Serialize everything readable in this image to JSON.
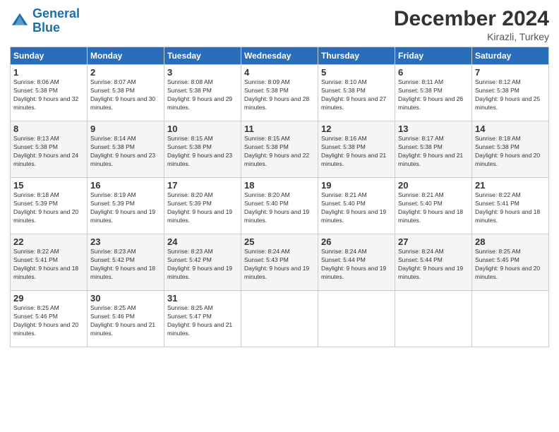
{
  "header": {
    "logo_line1": "General",
    "logo_line2": "Blue",
    "title": "December 2024",
    "subtitle": "Kirazli, Turkey"
  },
  "columns": [
    "Sunday",
    "Monday",
    "Tuesday",
    "Wednesday",
    "Thursday",
    "Friday",
    "Saturday"
  ],
  "weeks": [
    [
      {
        "day": "1",
        "sunrise": "8:06 AM",
        "sunset": "5:38 PM",
        "daylight": "9 hours and 32 minutes."
      },
      {
        "day": "2",
        "sunrise": "8:07 AM",
        "sunset": "5:38 PM",
        "daylight": "9 hours and 30 minutes."
      },
      {
        "day": "3",
        "sunrise": "8:08 AM",
        "sunset": "5:38 PM",
        "daylight": "9 hours and 29 minutes."
      },
      {
        "day": "4",
        "sunrise": "8:09 AM",
        "sunset": "5:38 PM",
        "daylight": "9 hours and 28 minutes."
      },
      {
        "day": "5",
        "sunrise": "8:10 AM",
        "sunset": "5:38 PM",
        "daylight": "9 hours and 27 minutes."
      },
      {
        "day": "6",
        "sunrise": "8:11 AM",
        "sunset": "5:38 PM",
        "daylight": "9 hours and 26 minutes."
      },
      {
        "day": "7",
        "sunrise": "8:12 AM",
        "sunset": "5:38 PM",
        "daylight": "9 hours and 25 minutes."
      }
    ],
    [
      {
        "day": "8",
        "sunrise": "8:13 AM",
        "sunset": "5:38 PM",
        "daylight": "9 hours and 24 minutes."
      },
      {
        "day": "9",
        "sunrise": "8:14 AM",
        "sunset": "5:38 PM",
        "daylight": "9 hours and 23 minutes."
      },
      {
        "day": "10",
        "sunrise": "8:15 AM",
        "sunset": "5:38 PM",
        "daylight": "9 hours and 23 minutes."
      },
      {
        "day": "11",
        "sunrise": "8:15 AM",
        "sunset": "5:38 PM",
        "daylight": "9 hours and 22 minutes."
      },
      {
        "day": "12",
        "sunrise": "8:16 AM",
        "sunset": "5:38 PM",
        "daylight": "9 hours and 21 minutes."
      },
      {
        "day": "13",
        "sunrise": "8:17 AM",
        "sunset": "5:38 PM",
        "daylight": "9 hours and 21 minutes."
      },
      {
        "day": "14",
        "sunrise": "8:18 AM",
        "sunset": "5:38 PM",
        "daylight": "9 hours and 20 minutes."
      }
    ],
    [
      {
        "day": "15",
        "sunrise": "8:18 AM",
        "sunset": "5:39 PM",
        "daylight": "9 hours and 20 minutes."
      },
      {
        "day": "16",
        "sunrise": "8:19 AM",
        "sunset": "5:39 PM",
        "daylight": "9 hours and 19 minutes."
      },
      {
        "day": "17",
        "sunrise": "8:20 AM",
        "sunset": "5:39 PM",
        "daylight": "9 hours and 19 minutes."
      },
      {
        "day": "18",
        "sunrise": "8:20 AM",
        "sunset": "5:40 PM",
        "daylight": "9 hours and 19 minutes."
      },
      {
        "day": "19",
        "sunrise": "8:21 AM",
        "sunset": "5:40 PM",
        "daylight": "9 hours and 19 minutes."
      },
      {
        "day": "20",
        "sunrise": "8:21 AM",
        "sunset": "5:40 PM",
        "daylight": "9 hours and 18 minutes."
      },
      {
        "day": "21",
        "sunrise": "8:22 AM",
        "sunset": "5:41 PM",
        "daylight": "9 hours and 18 minutes."
      }
    ],
    [
      {
        "day": "22",
        "sunrise": "8:22 AM",
        "sunset": "5:41 PM",
        "daylight": "9 hours and 18 minutes."
      },
      {
        "day": "23",
        "sunrise": "8:23 AM",
        "sunset": "5:42 PM",
        "daylight": "9 hours and 18 minutes."
      },
      {
        "day": "24",
        "sunrise": "8:23 AM",
        "sunset": "5:42 PM",
        "daylight": "9 hours and 19 minutes."
      },
      {
        "day": "25",
        "sunrise": "8:24 AM",
        "sunset": "5:43 PM",
        "daylight": "9 hours and 19 minutes."
      },
      {
        "day": "26",
        "sunrise": "8:24 AM",
        "sunset": "5:44 PM",
        "daylight": "9 hours and 19 minutes."
      },
      {
        "day": "27",
        "sunrise": "8:24 AM",
        "sunset": "5:44 PM",
        "daylight": "9 hours and 19 minutes."
      },
      {
        "day": "28",
        "sunrise": "8:25 AM",
        "sunset": "5:45 PM",
        "daylight": "9 hours and 20 minutes."
      }
    ],
    [
      {
        "day": "29",
        "sunrise": "8:25 AM",
        "sunset": "5:46 PM",
        "daylight": "9 hours and 20 minutes."
      },
      {
        "day": "30",
        "sunrise": "8:25 AM",
        "sunset": "5:46 PM",
        "daylight": "9 hours and 21 minutes."
      },
      {
        "day": "31",
        "sunrise": "8:25 AM",
        "sunset": "5:47 PM",
        "daylight": "9 hours and 21 minutes."
      },
      null,
      null,
      null,
      null
    ]
  ]
}
